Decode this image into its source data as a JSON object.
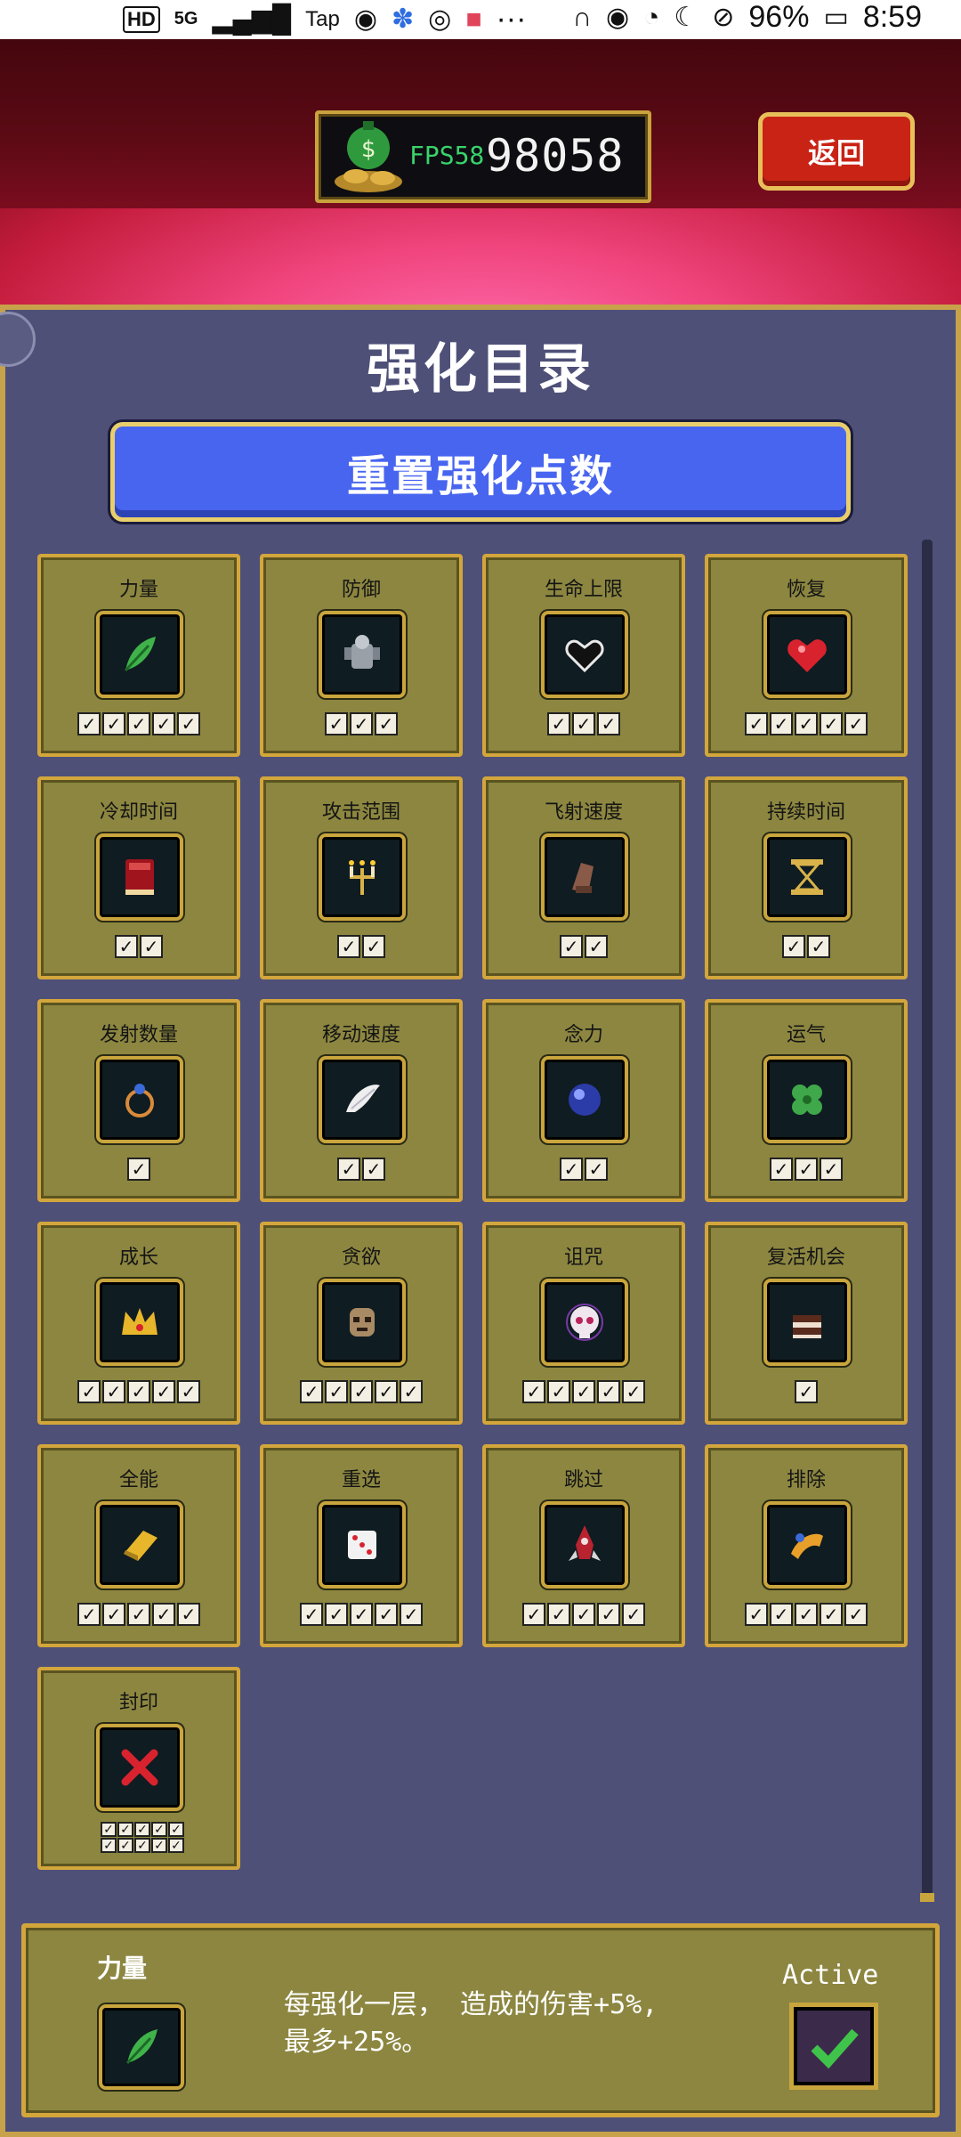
{
  "status_bar": {
    "hd": "HD",
    "network": "5G",
    "app_label": "Tap",
    "more": "···",
    "battery": "96%",
    "time": "8:59"
  },
  "header": {
    "fps": "FPS58",
    "gold": "98058",
    "back_label": "返回"
  },
  "panel": {
    "title": "强化目录",
    "reset_label": "重置强化点数"
  },
  "colors": {
    "accent_gold": "#c9a53d",
    "card_bg": "#8c8640",
    "panel_bg": "#4e5078",
    "reset_blue": "#4865f0",
    "back_red": "#c92315"
  },
  "powerups": [
    {
      "label": "力量",
      "icon": "leaf-icon",
      "levels": 5
    },
    {
      "label": "防御",
      "icon": "armor-icon",
      "levels": 3
    },
    {
      "label": "生命上限",
      "icon": "heart-outline-icon",
      "levels": 3
    },
    {
      "label": "恢复",
      "icon": "heart-gem-icon",
      "levels": 5
    },
    {
      "label": "冷却时间",
      "icon": "red-tome-icon",
      "levels": 2
    },
    {
      "label": "攻击范围",
      "icon": "candelabra-icon",
      "levels": 2
    },
    {
      "label": "飞射速度",
      "icon": "gauntlet-icon",
      "levels": 2
    },
    {
      "label": "持续时间",
      "icon": "hourglass-icon",
      "levels": 2
    },
    {
      "label": "发射数量",
      "icon": "ring-icon",
      "levels": 1
    },
    {
      "label": "移动速度",
      "icon": "wing-icon",
      "levels": 2
    },
    {
      "label": "念力",
      "icon": "orb-icon",
      "levels": 2
    },
    {
      "label": "运气",
      "icon": "clover-icon",
      "levels": 3
    },
    {
      "label": "成长",
      "icon": "crown-icon",
      "levels": 5
    },
    {
      "label": "贪欲",
      "icon": "mask-icon",
      "levels": 5
    },
    {
      "label": "诅咒",
      "icon": "skull-icon",
      "levels": 5
    },
    {
      "label": "复活机会",
      "icon": "cake-icon",
      "levels": 1
    },
    {
      "label": "全能",
      "icon": "gold-bar-icon",
      "levels": 5
    },
    {
      "label": "重选",
      "icon": "dice-icon",
      "levels": 5
    },
    {
      "label": "跳过",
      "icon": "rocket-icon",
      "levels": 5
    },
    {
      "label": "排除",
      "icon": "horn-icon",
      "levels": 5
    },
    {
      "label": "封印",
      "icon": "red-x-icon",
      "levels": 10
    }
  ],
  "detail": {
    "name": "力量",
    "icon": "leaf-icon",
    "description_line1": "每强化一层， 造成的伤害+5%,",
    "description_line2": "最多+25%。",
    "active_label": "Active",
    "active_checked": true
  }
}
